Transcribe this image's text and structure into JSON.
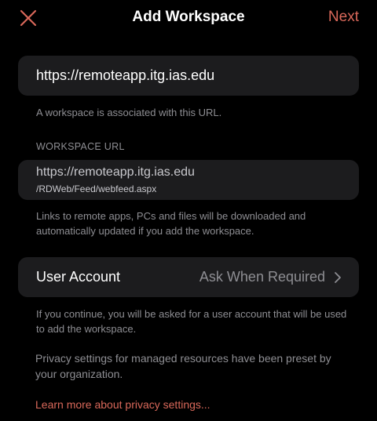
{
  "colors": {
    "background": "#000000",
    "card": "#1c1c1e",
    "accent": "#d9685a",
    "secondary_text": "#8e8e93"
  },
  "nav": {
    "close_icon": "x-icon",
    "title": "Add Workspace",
    "next_label": "Next"
  },
  "url_field": {
    "value": "https://remoteapp.itg.ias.edu",
    "footnote": "A workspace is associated with this URL."
  },
  "workspace_url": {
    "header": "WORKSPACE URL",
    "line1": "https://remoteapp.itg.ias.edu",
    "line2": "/RDWeb/Feed/webfeed.aspx",
    "footnote": "Links to remote apps, PCs and files will be downloaded and automatically updated if you add the workspace."
  },
  "user_account": {
    "label": "User Account",
    "value": "Ask When Required",
    "chevron_icon": "chevron-right-icon",
    "footnote": "If you continue, you will be asked for a user account that will be used to add the workspace."
  },
  "privacy": {
    "text": "Privacy settings for managed resources have been preset by your organization.",
    "link_label": "Learn more about privacy settings..."
  }
}
